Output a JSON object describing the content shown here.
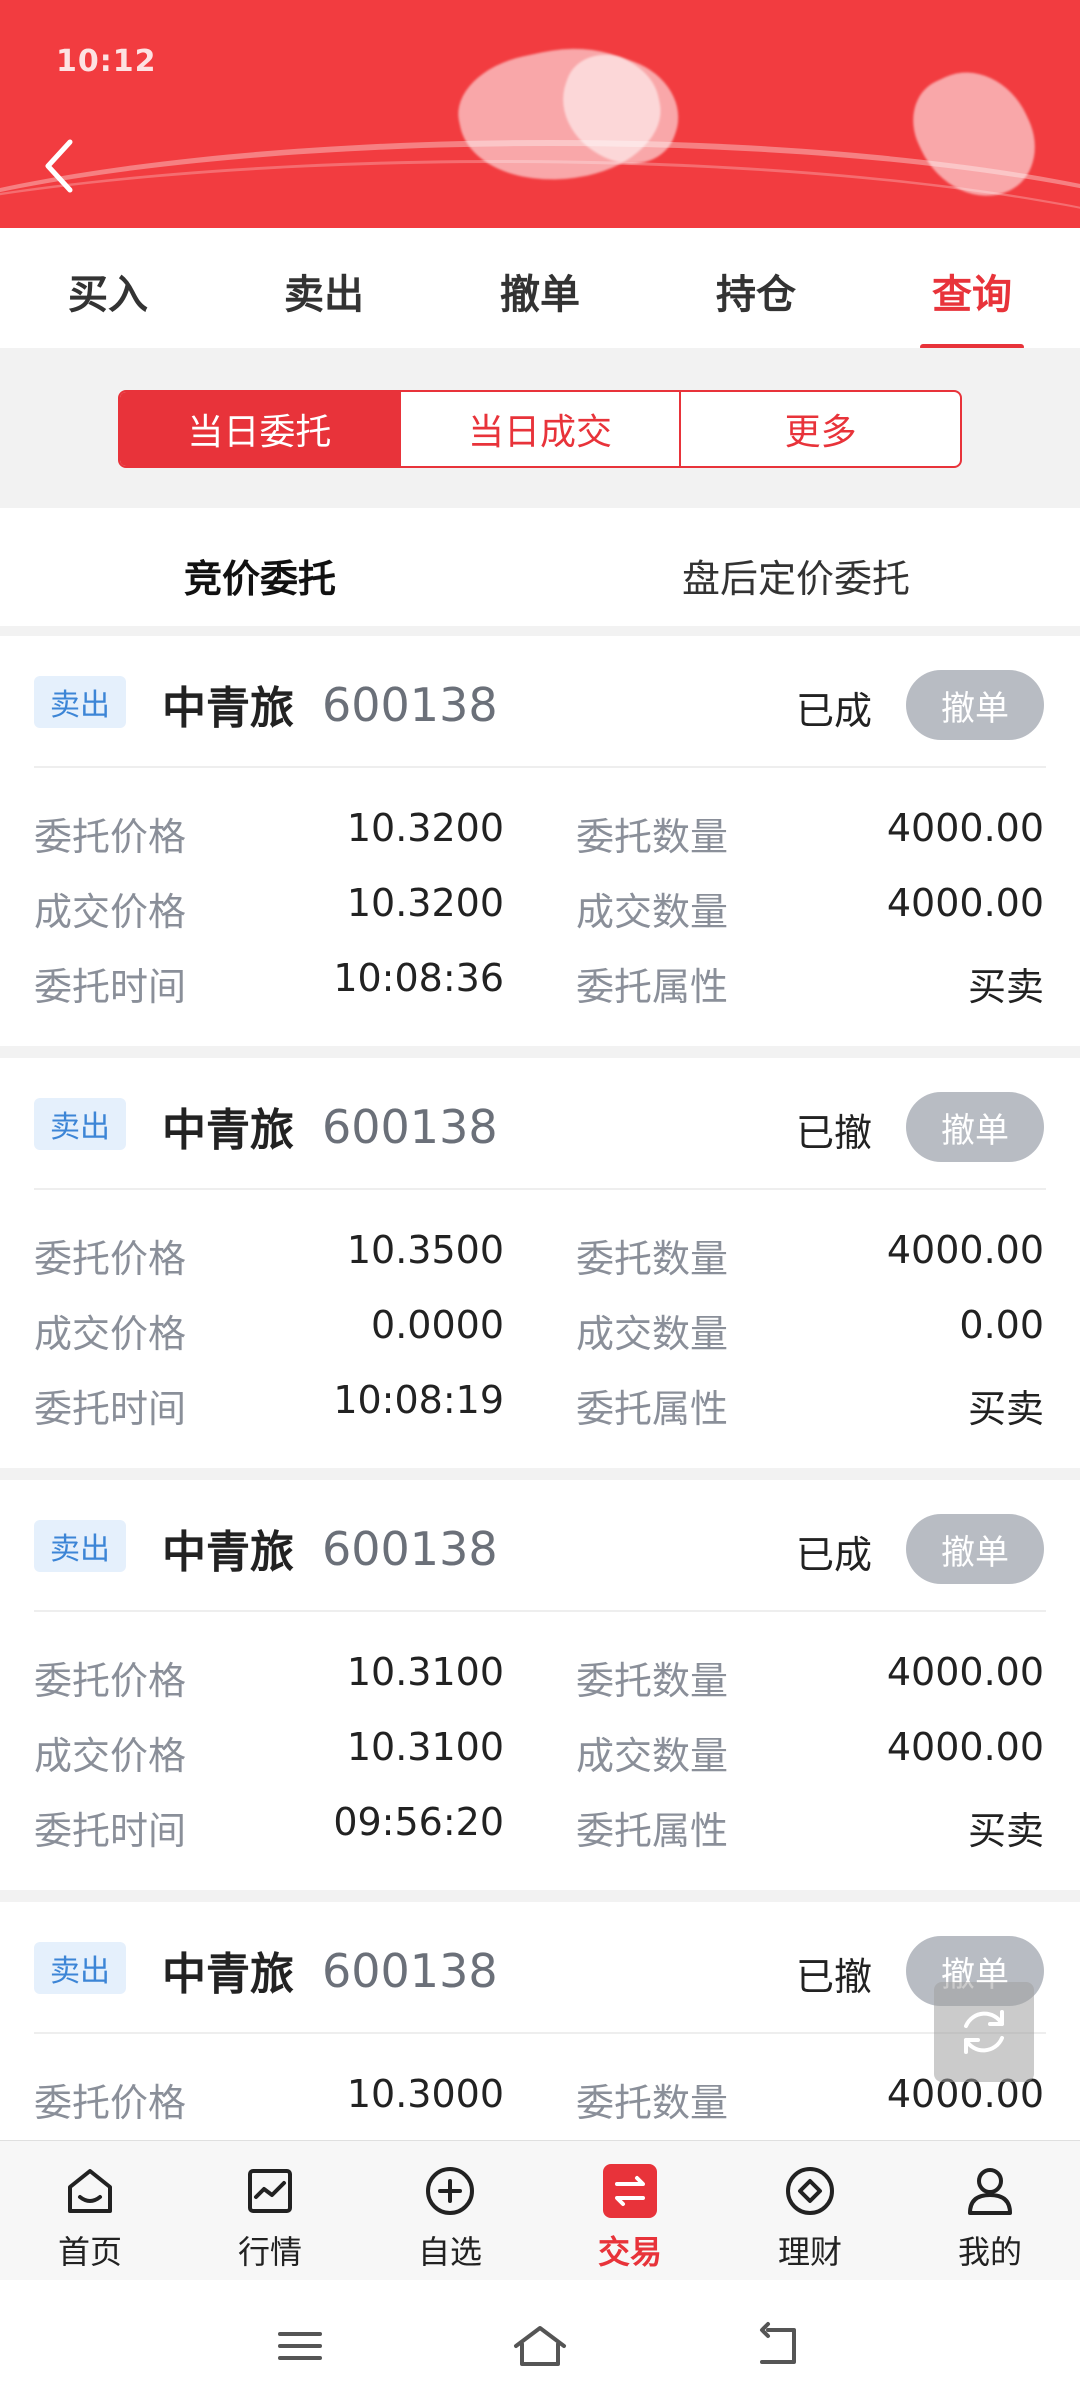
{
  "status_bar": {
    "time": "10:12"
  },
  "tabs": [
    {
      "label": "买入",
      "active": false
    },
    {
      "label": "卖出",
      "active": false
    },
    {
      "label": "撤单",
      "active": false
    },
    {
      "label": "持仓",
      "active": false
    },
    {
      "label": "查询",
      "active": true
    }
  ],
  "segments": [
    "当日委托",
    "当日成交",
    "更多"
  ],
  "subtabs": [
    "竞价委托",
    "盘后定价委托"
  ],
  "labels": {
    "order_price": "委托价格",
    "order_qty": "委托数量",
    "deal_price": "成交价格",
    "deal_qty": "成交数量",
    "order_time": "委托时间",
    "order_attr": "委托属性"
  },
  "orders": [
    {
      "side": "卖出",
      "name": "中青旅",
      "code": "600138",
      "status": "已成",
      "cancel": "撤单",
      "order_price": "10.3200",
      "order_qty": "4000.00",
      "deal_price": "10.3200",
      "deal_qty": "4000.00",
      "order_time": "10:08:36",
      "order_attr": "买卖"
    },
    {
      "side": "卖出",
      "name": "中青旅",
      "code": "600138",
      "status": "已撤",
      "cancel": "撤单",
      "order_price": "10.3500",
      "order_qty": "4000.00",
      "deal_price": "0.0000",
      "deal_qty": "0.00",
      "order_time": "10:08:19",
      "order_attr": "买卖"
    },
    {
      "side": "卖出",
      "name": "中青旅",
      "code": "600138",
      "status": "已成",
      "cancel": "撤单",
      "order_price": "10.3100",
      "order_qty": "4000.00",
      "deal_price": "10.3100",
      "deal_qty": "4000.00",
      "order_time": "09:56:20",
      "order_attr": "买卖"
    },
    {
      "side": "卖出",
      "name": "中青旅",
      "code": "600138",
      "status": "已撤",
      "cancel": "撤单",
      "order_price": "10.3000",
      "order_qty": "4000.00"
    }
  ],
  "bottom_nav": [
    {
      "label": "首页",
      "icon": "home-icon"
    },
    {
      "label": "行情",
      "icon": "chart-icon"
    },
    {
      "label": "自选",
      "icon": "plus-circle-icon"
    },
    {
      "label": "交易",
      "icon": "exchange-icon",
      "active": true
    },
    {
      "label": "理财",
      "icon": "diamond-icon"
    },
    {
      "label": "我的",
      "icon": "user-icon"
    }
  ],
  "colors": {
    "accent": "#e8333a",
    "header": "#f23c40",
    "badge_bg": "#e5f0fc",
    "badge_text": "#3c85d6"
  }
}
